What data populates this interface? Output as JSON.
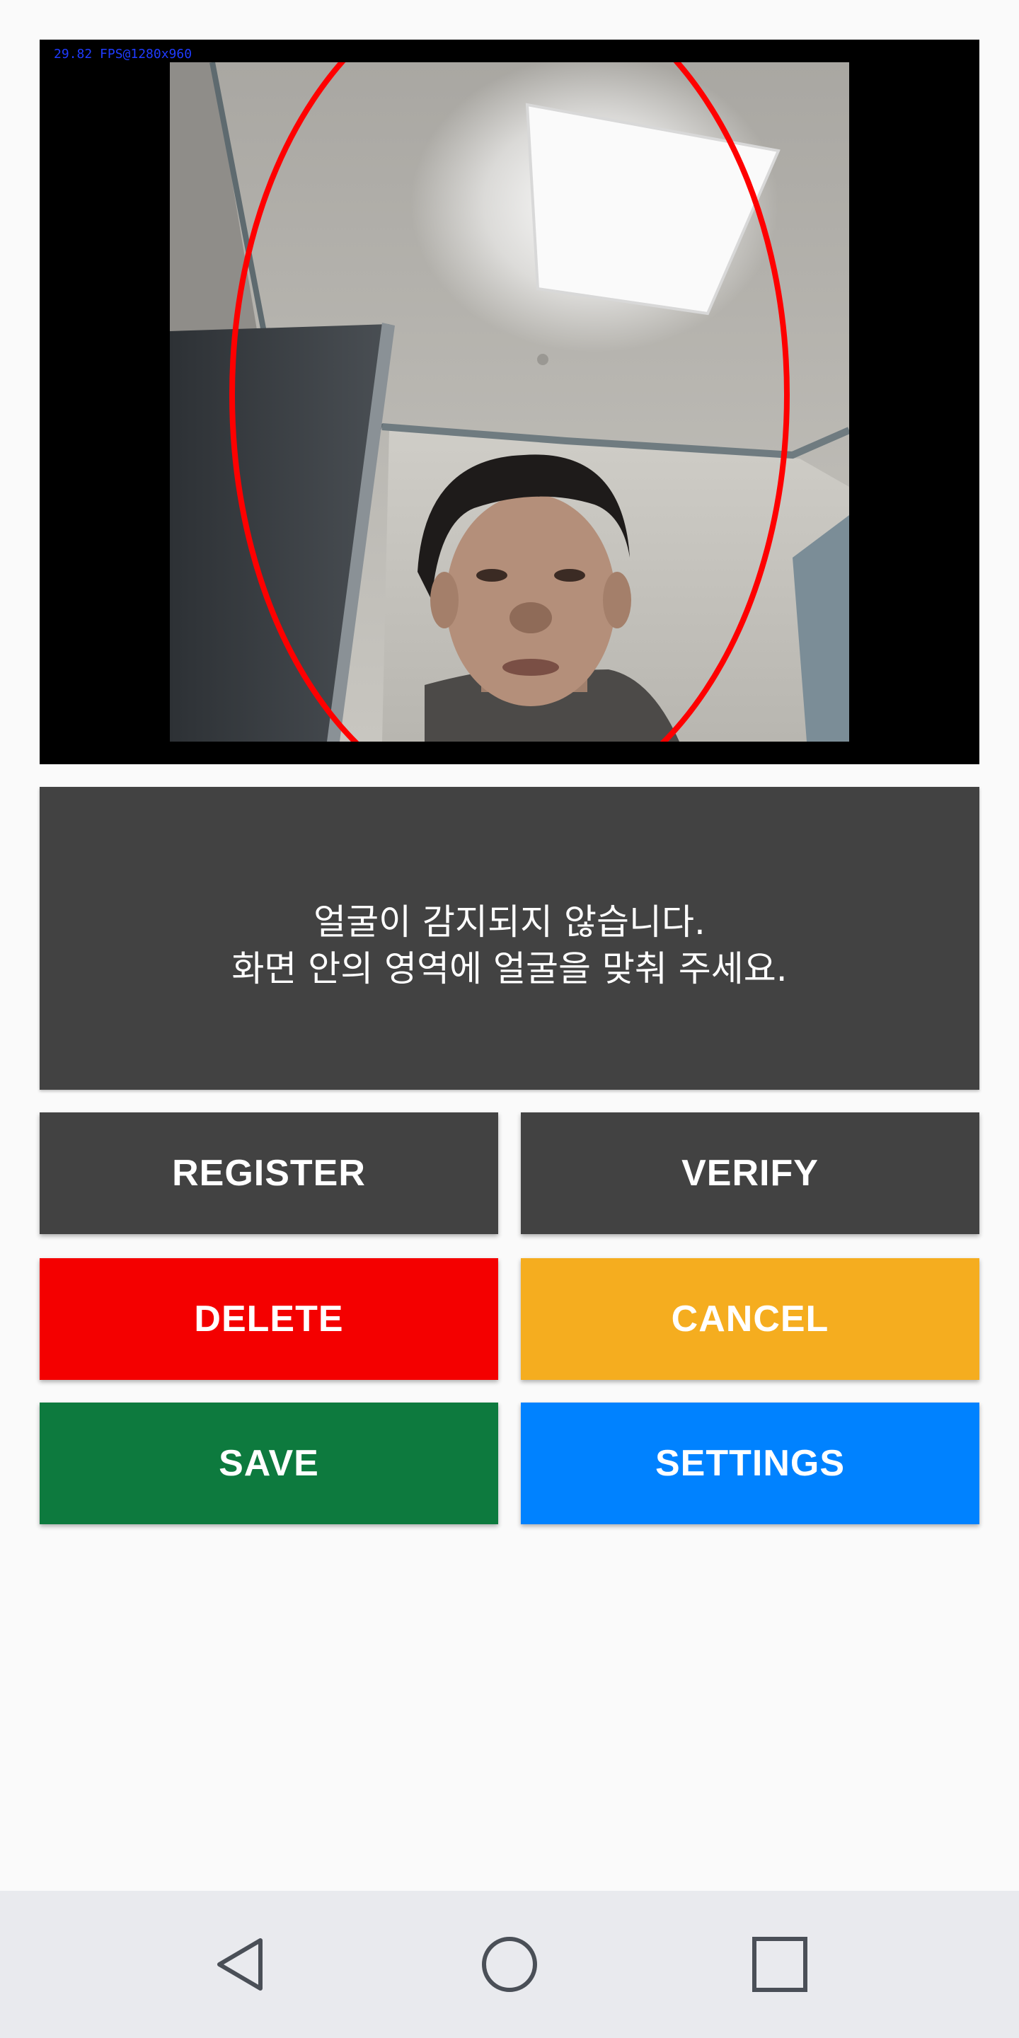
{
  "camera": {
    "fps_overlay": "29.82 FPS@1280x960",
    "face_guide_color": "#ff0000",
    "overlay_text_color": "#1f3bff"
  },
  "message": {
    "line1": "얼굴이 감지되지 않습니다.",
    "line2": "화면 안의 영역에 얼굴을 맞춰 주세요."
  },
  "buttons": {
    "register": "REGISTER",
    "verify": "VERIFY",
    "delete": "DELETE",
    "cancel": "CANCEL",
    "save": "SAVE",
    "settings": "SETTINGS"
  },
  "colors": {
    "dark": "#424242",
    "delete": "#f40000",
    "cancel": "#f5ad1f",
    "save": "#0d7a3e",
    "settings": "#0082ff"
  },
  "navbar": {
    "icons": [
      "back-icon",
      "home-icon",
      "recents-icon"
    ]
  }
}
